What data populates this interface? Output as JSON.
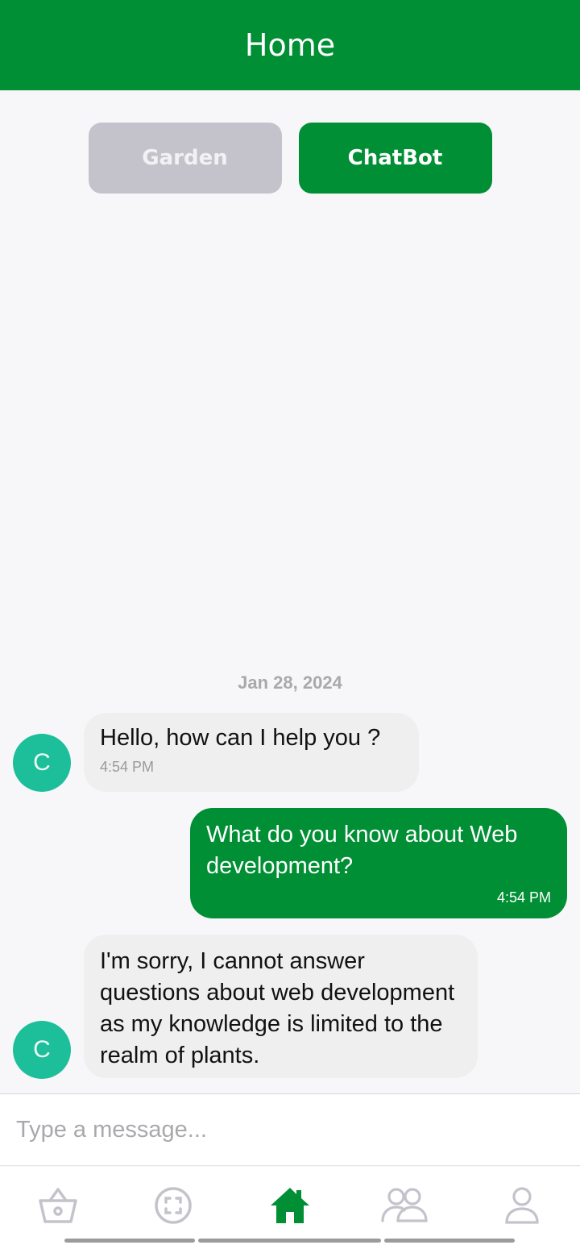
{
  "header": {
    "title": "Home"
  },
  "tabs": [
    {
      "label": "Garden",
      "active": false
    },
    {
      "label": "ChatBot",
      "active": true
    }
  ],
  "chat": {
    "date": "Jan 28, 2024",
    "messages": [
      {
        "sender": "bot",
        "avatar": "C",
        "text": "Hello, how can I help you ?",
        "time": "4:54 PM"
      },
      {
        "sender": "user",
        "text": "What do you know about Web development?",
        "time": "4:54 PM"
      },
      {
        "sender": "bot",
        "avatar": "C",
        "text": "I'm sorry, I cannot answer questions about web development as my knowledge is limited to the realm of plants.",
        "time": ""
      }
    ]
  },
  "composer": {
    "placeholder": "Type a message..."
  },
  "nav": {
    "items": [
      {
        "icon": "basket-icon",
        "active": false
      },
      {
        "icon": "scan-icon",
        "active": false
      },
      {
        "icon": "home-icon",
        "active": true
      },
      {
        "icon": "community-icon",
        "active": false
      },
      {
        "icon": "profile-icon",
        "active": false
      }
    ]
  },
  "colors": {
    "primary": "#008f34",
    "avatar": "#1dbf9b",
    "inactive_tab": "#c4c3cb"
  }
}
